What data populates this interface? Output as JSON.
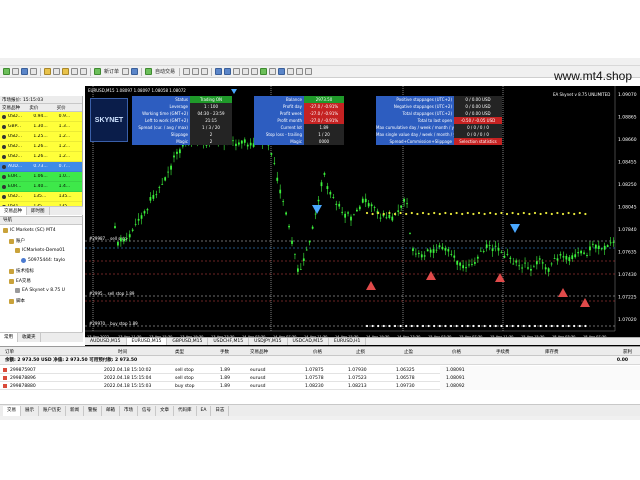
{
  "watermark": "www.mt4.shop",
  "toolbar": {
    "new_order_label": "新订单",
    "autotrade_label": "自动交易"
  },
  "market_watch": {
    "title": "市场报价: 15:15:03",
    "columns": [
      "交易品种",
      "卖价",
      "买价"
    ],
    "rows": [
      {
        "symbol": "USD...",
        "bid": "0.94...",
        "ask": "0.9...",
        "color": "yellow"
      },
      {
        "symbol": "GBP...",
        "bid": "1.30...",
        "ask": "1.3...",
        "color": "yellow"
      },
      {
        "symbol": "USD...",
        "bid": "1.25...",
        "ask": "1.2...",
        "color": "yellow"
      },
      {
        "symbol": "USD...",
        "bid": "1.26...",
        "ask": "1.2...",
        "color": "yellow"
      },
      {
        "symbol": "USD...",
        "bid": "1.26...",
        "ask": "1.2...",
        "color": "yellow"
      },
      {
        "symbol": "AUD...",
        "bid": "0.73...",
        "ask": "0.7...",
        "color": "blue"
      },
      {
        "symbol": "EUR...",
        "bid": "1.06...",
        "ask": "1.0...",
        "color": "green"
      },
      {
        "symbol": "EUR...",
        "bid": "1.40...",
        "ask": "1.4...",
        "color": "green"
      },
      {
        "symbol": "USD...",
        "bid": "135...",
        "ask": "135...",
        "color": "yellow"
      },
      {
        "symbol": "USD...",
        "bid": "135...",
        "ask": "135...",
        "color": "yellow"
      }
    ],
    "tabs": [
      "交易品种",
      "即时图"
    ]
  },
  "navigator": {
    "title": "导航",
    "items": [
      {
        "label": "IC Markets (SC) MT4",
        "indent": 0,
        "icon": "platform"
      },
      {
        "label": "账户",
        "indent": 1,
        "icon": "folder"
      },
      {
        "label": "ICMarkets-Demo01",
        "indent": 2,
        "icon": "server"
      },
      {
        "label": "50975444: taylo",
        "indent": 3,
        "icon": "user"
      },
      {
        "label": "技术指标",
        "indent": 1,
        "icon": "folder"
      },
      {
        "label": "EA交易",
        "indent": 1,
        "icon": "folder"
      },
      {
        "label": "EA Skynet v 8.75 U",
        "indent": 2,
        "icon": "expert"
      },
      {
        "label": "脚本",
        "indent": 1,
        "icon": "folder"
      }
    ],
    "tabs": [
      "常用",
      "收藏夹"
    ]
  },
  "chart": {
    "info_line": "EURUSD,M15  1.08097 1.08097 1.08058 1.08072",
    "title": "EA Skynet v 8.75 UNLIMITED",
    "logo_text": "SKYNET",
    "panel": {
      "col1": [
        {
          "label": "Status",
          "value": "Trading ON",
          "style": "green"
        },
        {
          "label": "Leverage",
          "value": "1 : 100",
          "style": "dk"
        },
        {
          "label": "Working time (GMT+2)",
          "value": "04:30 - 23:59",
          "style": "dk"
        },
        {
          "label": "Left to work (GMT+2)",
          "value": "21:15",
          "style": "dk"
        },
        {
          "label": "Spread (cur. / avg / max)",
          "value": "1 / 3 / 20",
          "style": "dk"
        },
        {
          "label": "Slippage",
          "value": "2",
          "style": "dk"
        },
        {
          "label": "Magic",
          "value": "2",
          "style": "dk"
        }
      ],
      "col2": [
        {
          "label": "Balance",
          "value": "2973.50",
          "style": "green"
        },
        {
          "label": "Profit day",
          "value": "-27.0 / -0.91%",
          "style": "red"
        },
        {
          "label": "Profit week",
          "value": "-27.0 / -0.91%",
          "style": "red"
        },
        {
          "label": "Profit month",
          "value": "-27.0 / -0.91%",
          "style": "red"
        },
        {
          "label": "Current lot",
          "value": "1.89",
          "style": "dk"
        },
        {
          "label": "Stop loss - trailing",
          "value": "1 / 20",
          "style": "dk"
        },
        {
          "label": "Magic",
          "value": "0000",
          "style": "dk"
        }
      ],
      "col3": [
        {
          "label": "Positive stoppages (UTC+2)",
          "value": "0 / 0.00 USD",
          "style": "dk"
        },
        {
          "label": "Negative stoppages (UTC+2)",
          "value": "0 / 0.00 USD",
          "style": "dk"
        },
        {
          "label": "Total stoppages (UTC+2)",
          "value": "0 / 0.00 USD",
          "style": "dk"
        },
        {
          "label": "Total to last open",
          "value": "-0.50 / -0.05 USD",
          "style": "red"
        },
        {
          "label": "Max cumulative day / week / month / year",
          "value": "0 / 0 / 0 / 0",
          "style": "dk"
        },
        {
          "label": "Max single value day / week / month / year",
          "value": "0 / 0 / 0 / 0",
          "style": "dk"
        },
        {
          "label": "Spread+Commission+Slippage",
          "value": "Selection statistics",
          "style": "red"
        }
      ]
    },
    "price_labels": [
      "1.09070",
      "1.08865",
      "1.08660",
      "1.08455",
      "1.08250",
      "1.08045",
      "1.07840",
      "1.07635",
      "1.07430",
      "1.07225",
      "1.07020"
    ],
    "time_labels": [
      "13 Apr 2022",
      "13 Apr 11:30",
      "13 Apr 15:30",
      "13 Apr 19:30",
      "13 Apr 23:30",
      "14 Apr 03:30",
      "14 Apr 07:30",
      "14 Apr 11:30",
      "14 Apr 15:30",
      "14 Apr 19:30",
      "14 Apr 23:30",
      "15 Apr 03:30",
      "15 Apr 07:30",
      "15 Apr 11:30",
      "15 Apr 15:30",
      "18 Apr 03:30",
      "18 Apr 07:30"
    ],
    "line_labels": [
      "#29987... sell stop",
      "#2995... sell stop 1.89",
      "#29970... buy stop 1.89"
    ],
    "tabs": [
      "AUDUSD,M15",
      "EURUSD,M15",
      "GBPUSD,M15",
      "USDCHF,M15",
      "USDJPY,M15",
      "USDCAD,M15",
      "EURUSD,H1"
    ]
  },
  "terminal": {
    "columns": [
      "订单",
      "时间",
      "类型",
      "手数",
      "交易品种",
      "价格",
      "止损",
      "止盈",
      "价格",
      "手续费",
      "库存费",
      "获利"
    ],
    "balance_line": "余额: 2 973.50 USD  净值: 2 973.50  可用预付款: 2 973.50",
    "balance_profit": "0.00",
    "orders": [
      {
        "order": "299875907",
        "time": "2022.04.18 15:10:02",
        "type": "sell stop",
        "lots": "1.89",
        "symbol": "eurusd",
        "price": "1.07875",
        "sl": "1.07930",
        "tp": "1.06325",
        "cur_price": "1.08091"
      },
      {
        "order": "299878896",
        "time": "2022.04.18 15:15:04",
        "type": "sell stop",
        "lots": "1.89",
        "symbol": "eurusd",
        "price": "1.07578",
        "sl": "1.07523",
        "tp": "1.06578",
        "cur_price": "1.08091"
      },
      {
        "order": "299878880",
        "time": "2022.04.18 15:15:03",
        "type": "buy stop",
        "lots": "1.89",
        "symbol": "eurusd",
        "price": "1.08230",
        "sl": "1.08213",
        "tp": "1.09730",
        "cur_price": "1.08092"
      }
    ],
    "tabs": [
      "交易",
      "展示",
      "账户历史",
      "新闻",
      "警报",
      "邮箱",
      "市场",
      "信号",
      "文章",
      "代码库",
      "EA",
      "日志"
    ]
  }
}
